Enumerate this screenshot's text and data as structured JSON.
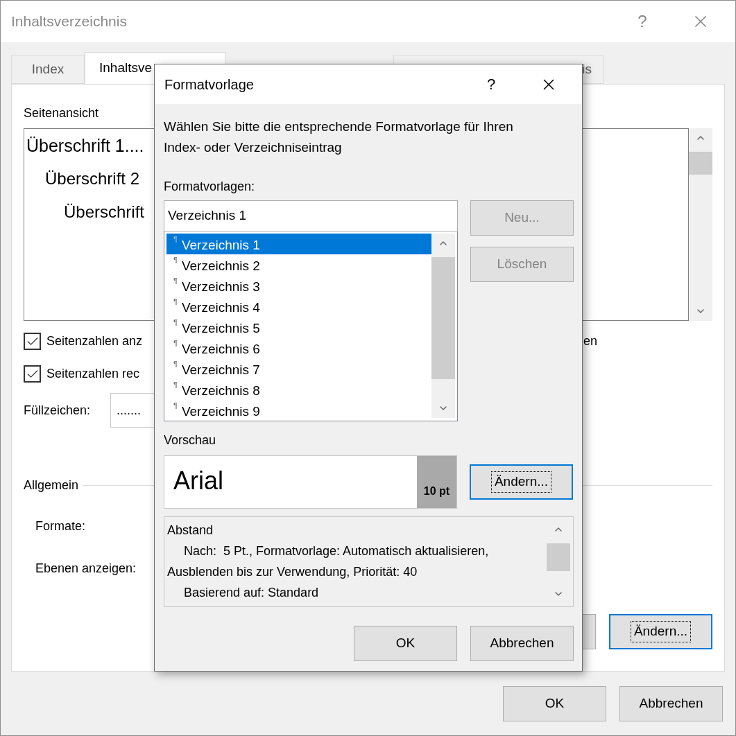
{
  "window": {
    "title": "Inhaltsverzeichnis",
    "help": "?"
  },
  "tabs": [
    {
      "label": "Index",
      "selected": false
    },
    {
      "label": "Inhaltsve",
      "selected": true
    },
    {
      "label": "is",
      "selected": false
    }
  ],
  "preview_label": "Seitenansicht",
  "preview_headings": [
    {
      "text": "Überschrift 1....",
      "children": [
        {
          "text": "Überschrift 2",
          "children": [
            {
              "text": "Überschrift"
            }
          ]
        }
      ]
    }
  ],
  "options": [
    {
      "label": "Seitenzahlen anz",
      "checked": true
    },
    {
      "label": "Seitenzahlen rec",
      "checked": true
    }
  ],
  "option_fragment": "en",
  "fill_char": {
    "label": "Füllzeichen:",
    "value": "......."
  },
  "general": {
    "title": "Allgemein",
    "fields": [
      "Formate:",
      "Ebenen anzeigen:"
    ]
  },
  "panel_button": {
    "label": "Ändern...",
    "focused": true
  },
  "buttons": [
    "OK",
    "Abbrechen"
  ],
  "dialog": {
    "title": "Formatvorlage",
    "help": "?",
    "description": "Wählen Sie bitte die entsprechende Formatvorlage für Ihren Index- oder Verzeichniseintrag",
    "styles_label": "Formatvorlagen:",
    "style_name": "Verzeichnis 1",
    "styles": [
      {
        "marker": "¶",
        "name": "Verzeichnis 1",
        "selected": true
      },
      {
        "marker": "¶",
        "name": "Verzeichnis 2",
        "selected": false
      },
      {
        "marker": "¶",
        "name": "Verzeichnis 3",
        "selected": false
      },
      {
        "marker": "¶",
        "name": "Verzeichnis 4",
        "selected": false
      },
      {
        "marker": "¶",
        "name": "Verzeichnis 5",
        "selected": false
      },
      {
        "marker": "¶",
        "name": "Verzeichnis 6",
        "selected": false
      },
      {
        "marker": "¶",
        "name": "Verzeichnis 7",
        "selected": false
      },
      {
        "marker": "¶",
        "name": "Verzeichnis 8",
        "selected": false
      },
      {
        "marker": "¶",
        "name": "Verzeichnis 9",
        "selected": false
      }
    ],
    "side_buttons": [
      {
        "label": "Neu...",
        "disabled": true
      },
      {
        "label": "Löschen",
        "disabled": true
      }
    ],
    "preview_label": "Vorschau",
    "preview": {
      "font": "Arial",
      "size": "10 pt"
    },
    "modify_button": {
      "label": "Ändern...",
      "focused": true
    },
    "details": [
      {
        "text": "Abstand",
        "indented": false
      },
      {
        "text": "Nach:  5 Pt., Formatvorlage: Automatisch aktualisieren, Ausblenden bis zur Verwendung, Priorität: 40",
        "indented": true
      },
      {
        "text": "Basierend auf: Standard",
        "indented": true
      }
    ],
    "buttons": [
      "OK",
      "Abbrechen"
    ]
  }
}
